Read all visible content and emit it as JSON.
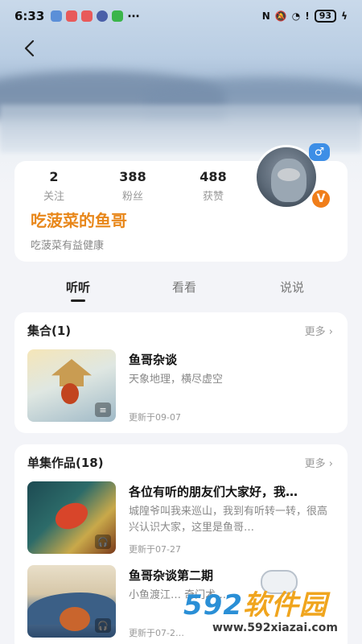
{
  "status_bar": {
    "time": "6:33",
    "battery": "93",
    "extra": "⋯"
  },
  "profile": {
    "stats": [
      {
        "value": "2",
        "label": "关注"
      },
      {
        "value": "388",
        "label": "粉丝"
      },
      {
        "value": "488",
        "label": "获赞"
      }
    ],
    "name": "吃菠菜的鱼哥",
    "bio": "吃菠菜有益健康",
    "gender_icon": "♂",
    "verify_icon": "V"
  },
  "tabs": [
    {
      "label": "听听",
      "active": true
    },
    {
      "label": "看看",
      "active": false
    },
    {
      "label": "说说",
      "active": false
    }
  ],
  "collections": {
    "title": "集合(1)",
    "more": "更多 ›",
    "items": [
      {
        "title": "鱼哥杂谈",
        "desc": "天象地理，横尽虚空",
        "date": "更新于09-07"
      }
    ]
  },
  "singles": {
    "title": "单集作品(18)",
    "more": "更多 ›",
    "items": [
      {
        "title": "各位有听的朋友们大家好，我…",
        "desc": "城隍爷叫我来巡山，我到有听转一转，很高兴认识大家，这里是鱼哥…",
        "date": "更新于07-27"
      },
      {
        "title": "鱼哥杂谈第二期",
        "desc": "小鱼渡江… 奇门术…",
        "date": "更新于07-2…"
      }
    ]
  },
  "watermark": {
    "brand_num": "592",
    "brand_text": "软件园",
    "url": "www.592xiazai.com"
  },
  "colors": {
    "accent_orange": "#e8871a",
    "badge_blue": "#3d8ee6",
    "verify_orange": "#f07e1a"
  }
}
